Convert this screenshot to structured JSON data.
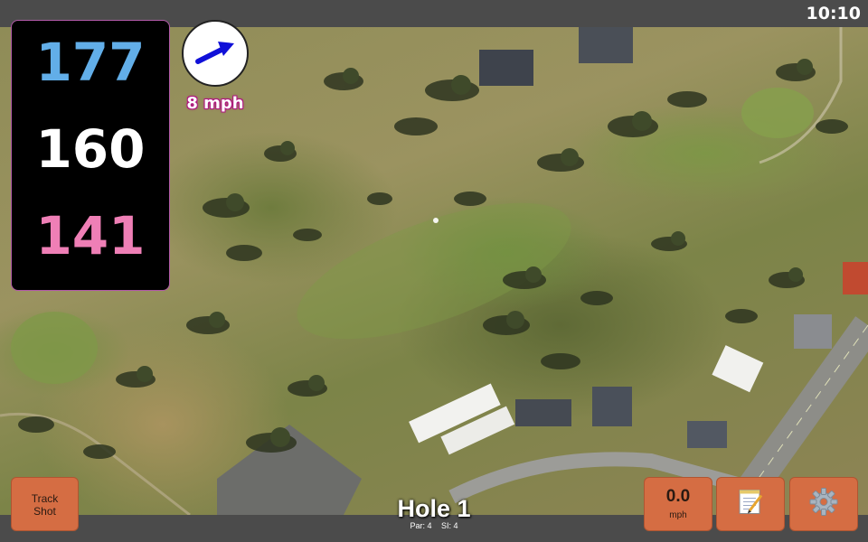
{
  "status": {
    "time": "10:10"
  },
  "distances": {
    "back": "177",
    "center": "160",
    "front": "141"
  },
  "wind": {
    "speed": "8 mph",
    "direction_icon": "arrow-east-northeast-icon"
  },
  "hole": {
    "title": "Hole 1",
    "par": "Par: 4",
    "si": "SI: 4"
  },
  "buttons": {
    "track_line1": "Track",
    "track_line2": "Shot",
    "speed_value": "0.0",
    "speed_unit": "mph",
    "notes_icon": "notepad-icon",
    "settings_icon": "gear-icon"
  },
  "colors": {
    "back": "#62aee8",
    "center": "#ffffff",
    "front": "#ef7fb6",
    "button": "#d56d43",
    "wind_outline": "#b0137f"
  }
}
